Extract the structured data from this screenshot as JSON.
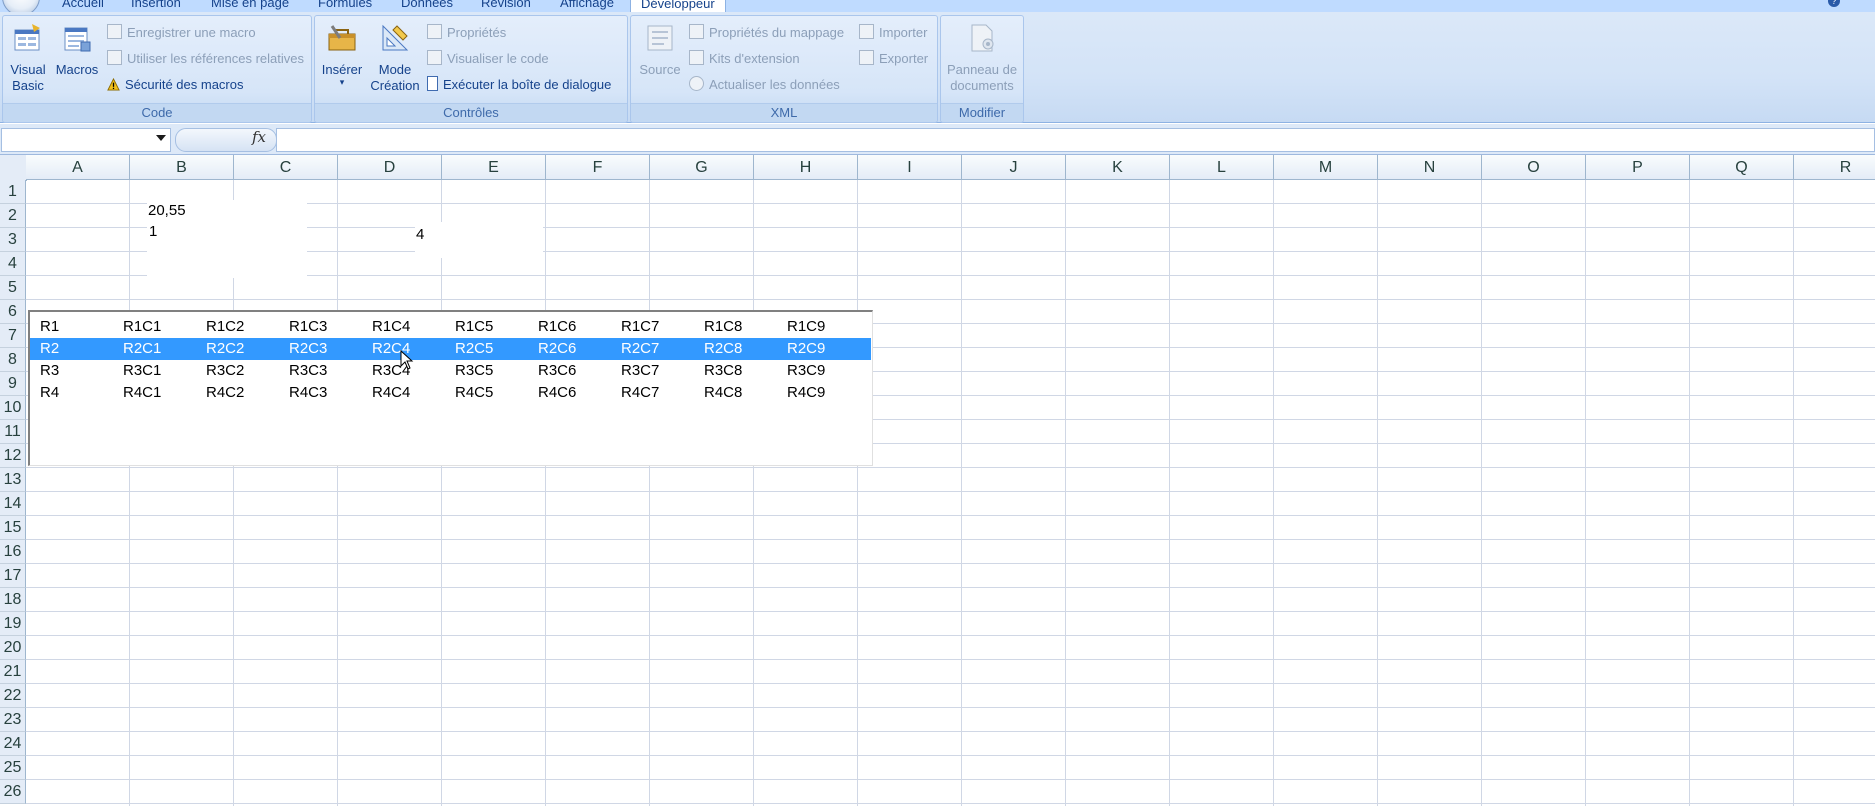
{
  "tabs": [
    {
      "label": "Accueil",
      "active": false
    },
    {
      "label": "Insertion",
      "active": false
    },
    {
      "label": "Mise en page",
      "active": false
    },
    {
      "label": "Formules",
      "active": false
    },
    {
      "label": "Données",
      "active": false
    },
    {
      "label": "Révision",
      "active": false
    },
    {
      "label": "Affichage",
      "active": false
    },
    {
      "label": "Développeur",
      "active": true
    }
  ],
  "ribbon": {
    "code": {
      "label": "Code",
      "visual_basic": "Visual\nBasic",
      "macros": "Macros",
      "record_macro": "Enregistrer une macro",
      "relative_refs": "Utiliser les références relatives",
      "macro_security": "Sécurité des macros"
    },
    "controls": {
      "label": "Contrôles",
      "insert": "Insérer",
      "design_mode": "Mode\nCréation",
      "properties": "Propriétés",
      "view_code": "Visualiser le code",
      "run_dialog": "Exécuter la boîte de dialogue"
    },
    "xml": {
      "label": "XML",
      "source": "Source",
      "map_properties": "Propriétés du mappage",
      "expansion_packs": "Kits d'extension",
      "refresh_data": "Actualiser les données",
      "import": "Importer",
      "export": "Exporter"
    },
    "modify": {
      "label": "Modifier",
      "document_panel": "Panneau de\ndocuments"
    }
  },
  "formula_bar": {
    "name_box": "",
    "fx": "fx",
    "formula": ""
  },
  "columns": [
    "A",
    "B",
    "C",
    "D",
    "E",
    "F",
    "G",
    "H",
    "I",
    "J",
    "K",
    "L",
    "M",
    "N",
    "O",
    "P",
    "Q",
    "R"
  ],
  "rows": [
    "1",
    "2",
    "3",
    "4",
    "5",
    "6",
    "7",
    "8",
    "9",
    "10",
    "11",
    "12",
    "13",
    "14",
    "15",
    "16",
    "17",
    "18",
    "19",
    "20",
    "21",
    "22",
    "23",
    "24",
    "25",
    "26"
  ],
  "cells": {
    "b2": "20,55",
    "b3": "1",
    "d3": "4"
  },
  "listbox": {
    "selected_index": 1,
    "rows": [
      [
        "R1",
        "R1C1",
        "R1C2",
        "R1C3",
        "R1C4",
        "R1C5",
        "R1C6",
        "R1C7",
        "R1C8",
        "R1C9"
      ],
      [
        "R2",
        "R2C1",
        "R2C2",
        "R2C3",
        "R2C4",
        "R2C5",
        "R2C6",
        "R2C7",
        "R2C8",
        "R2C9"
      ],
      [
        "R3",
        "R3C1",
        "R3C2",
        "R3C3",
        "R3C4",
        "R3C5",
        "R3C6",
        "R3C7",
        "R3C8",
        "R3C9"
      ],
      [
        "R4",
        "R4C1",
        "R4C2",
        "R4C3",
        "R4C4",
        "R4C5",
        "R4C6",
        "R4C7",
        "R4C8",
        "R4C9"
      ]
    ]
  },
  "colors": {
    "selection": "#3399ff",
    "gridline": "#d0d7e5",
    "ribbon": "#d3e3f7"
  }
}
